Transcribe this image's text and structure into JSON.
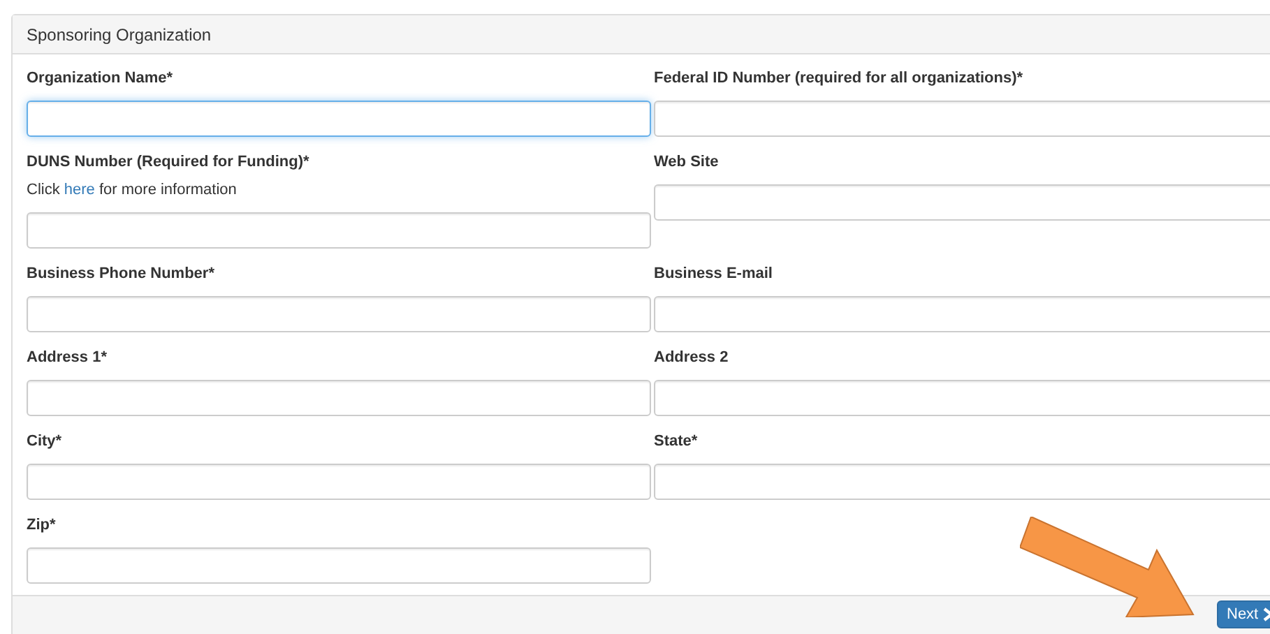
{
  "panel": {
    "title": "Sponsoring Organization"
  },
  "rows": [
    [
      {
        "label": "Organization Name*",
        "focused": true
      },
      {
        "label": "Federal ID Number (required for all organizations)*",
        "focused": false
      }
    ],
    [
      {
        "label": "DUNS Number (Required for Funding)*",
        "focused": false,
        "note": {
          "before": "Click ",
          "link": "here",
          "after": " for more information"
        }
      },
      {
        "label": "Web Site",
        "focused": false
      }
    ],
    [
      {
        "label": "Business Phone Number*",
        "focused": false
      },
      {
        "label": "Business E-mail",
        "focused": false
      }
    ],
    [
      {
        "label": "Address 1*",
        "focused": false
      },
      {
        "label": "Address 2",
        "focused": false
      }
    ],
    [
      {
        "label": "City*",
        "focused": false
      },
      {
        "label": "State*",
        "focused": false
      }
    ],
    [
      {
        "label": "Zip*",
        "focused": false
      }
    ]
  ],
  "footer": {
    "next_button": "Next"
  }
}
